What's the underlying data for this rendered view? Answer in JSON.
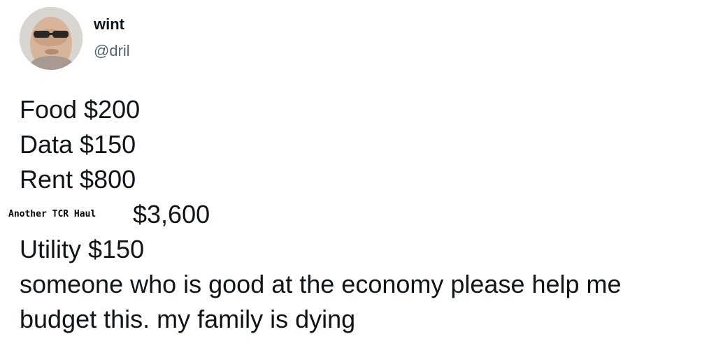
{
  "tweet": {
    "author": {
      "display_name": "wint",
      "handle": "@dril",
      "avatar_icon": "avatar-photo"
    },
    "lines": {
      "food": "Food $200",
      "data": "Data $150",
      "rent": "Rent $800",
      "overlay_label": "Another TCR Haul",
      "overlay_amount": "$3,600",
      "utility": "Utility $150",
      "text_1": "someone who is good at the economy please help me",
      "text_2": "budget this. my family is dying"
    }
  }
}
